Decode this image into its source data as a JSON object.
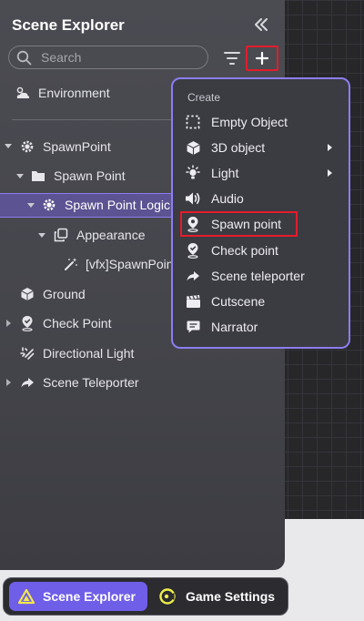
{
  "panel": {
    "title": "Scene Explorer",
    "search_placeholder": "Search"
  },
  "tree": [
    {
      "label": "Environment"
    },
    {
      "label": "SpawnPoint"
    },
    {
      "label": "Spawn Point"
    },
    {
      "label": "Spawn Point Logic"
    },
    {
      "label": "Appearance"
    },
    {
      "label": "[vfx]SpawnPoint"
    },
    {
      "label": "Ground"
    },
    {
      "label": "Check Point"
    },
    {
      "label": "Directional Light"
    },
    {
      "label": "Scene Teleporter"
    }
  ],
  "menu": {
    "header": "Create",
    "items": [
      {
        "label": "Empty Object"
      },
      {
        "label": "3D object"
      },
      {
        "label": "Light"
      },
      {
        "label": "Audio"
      },
      {
        "label": "Spawn point"
      },
      {
        "label": "Check point"
      },
      {
        "label": "Scene teleporter"
      },
      {
        "label": "Cutscene"
      },
      {
        "label": "Narrator"
      }
    ]
  },
  "tabs": [
    {
      "label": "Scene Explorer"
    },
    {
      "label": "Game Settings"
    }
  ],
  "colors": {
    "accent": "#6f5ee8",
    "highlight_red": "#e31c2b",
    "menu_border": "#8b7ef2"
  }
}
